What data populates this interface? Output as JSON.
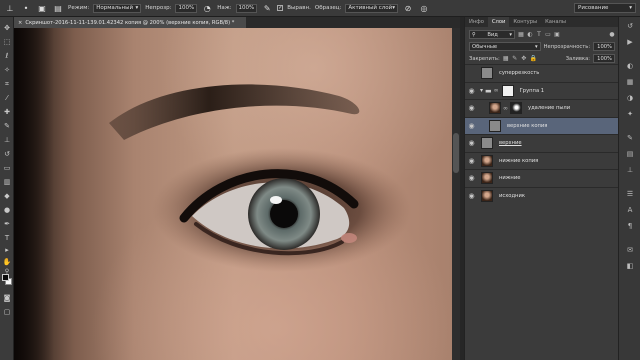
{
  "options_bar": {
    "mode_label": "Режим:",
    "mode_value": "Нормальный",
    "opacity_label": "Непрозр:",
    "opacity_value": "100%",
    "pressure_label": "Наж:",
    "pressure_value": "100%",
    "align_label": "Выравн.",
    "sample_label": "Образец:",
    "sample_value": "Активный слой",
    "workspace_value": "Рисование"
  },
  "document": {
    "tab_title": "Скриншот-2016-11-11-139.01.42342 копия @ 200% (верхние копия, RGB/8) *",
    "close_glyph": "×"
  },
  "panel": {
    "tabs": [
      "Инфо",
      "Слои",
      "Контуры",
      "Каналы"
    ],
    "active_tab": 1,
    "kind_value": "Вид",
    "blend_value": "Обычные",
    "opacity_label": "Непрозрачность:",
    "opacity_value": "100%",
    "lock_label": "Закрепить:",
    "fill_label": "Заливка:",
    "fill_value": "100%"
  },
  "layers": [
    {
      "name": "суперрезкость",
      "visible": false,
      "thumb": "gray",
      "selected": false
    },
    {
      "name": "Группа 1",
      "visible": true,
      "thumb": "folder",
      "selected": false,
      "group": true
    },
    {
      "name": "удаление пыли",
      "visible": true,
      "thumb": "photo",
      "mask": true,
      "selected": false
    },
    {
      "name": "верхние копия",
      "visible": true,
      "thumb": "gray",
      "selected": true
    },
    {
      "name": "верхние",
      "visible": true,
      "thumb": "gray",
      "selected": false,
      "underline": true
    },
    {
      "name": "нижние копия",
      "visible": true,
      "thumb": "photo",
      "selected": false
    },
    {
      "name": "нижние",
      "visible": true,
      "thumb": "photo",
      "selected": false
    },
    {
      "name": "исходник",
      "visible": true,
      "thumb": "photo",
      "selected": false
    }
  ]
}
